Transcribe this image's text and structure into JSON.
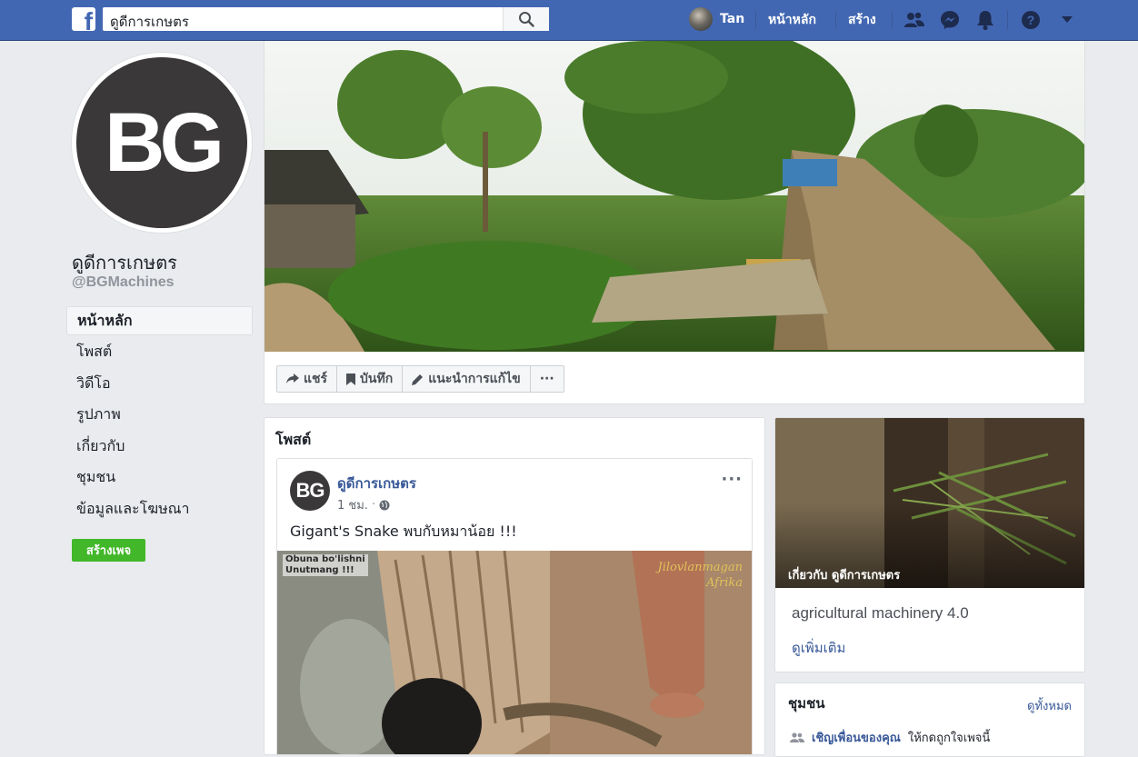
{
  "topbar": {
    "logo": "f",
    "search_value": "ดูดีการเกษตร",
    "user_name": "Tan",
    "home_label": "หน้าหลัก",
    "create_label": "สร้าง",
    "brand_color": "#4267b2"
  },
  "page": {
    "avatar_text": "BG",
    "name": "ดูดีการเกษตร",
    "handle": "@BGMachines"
  },
  "sidebar": {
    "items": [
      {
        "label": "หน้าหลัก"
      },
      {
        "label": "โพสต์"
      },
      {
        "label": "วิดีโอ"
      },
      {
        "label": "รูปภาพ"
      },
      {
        "label": "เกี่ยวกับ"
      },
      {
        "label": "ชุมชน"
      },
      {
        "label": "ข้อมูลและโฆษณา"
      }
    ],
    "create_page": "สร้างเพจ"
  },
  "cover": {
    "actions": {
      "share": "แชร์",
      "save": "บันทึก",
      "suggest_edit": "แนะนำการแก้ไข",
      "more": "···"
    }
  },
  "posts": {
    "title": "โพสต์",
    "post": {
      "author": "ดูดีการเกษตร",
      "avatar_text": "BG",
      "time": "1 ชม.",
      "text": "Gigant's Snake พบกับหมาน้อย !!!",
      "media_tag_line1": "Obuna bo'lishni",
      "media_tag_line2": "Unutmang !!!",
      "watermark_line1": "Jilovlanmagan",
      "watermark_line2": "Afrika"
    }
  },
  "about": {
    "caption": "เกี่ยวกับ ดูดีการเกษตร",
    "description": "agricultural machinery 4.0",
    "see_more": "ดูเพิ่มเติม"
  },
  "community": {
    "title": "ชุมชน",
    "see_all": "ดูทั้งหมด",
    "invite_link": "เชิญเพื่อนของคุณ",
    "invite_text": "ให้กดถูกใจเพจนี้"
  }
}
